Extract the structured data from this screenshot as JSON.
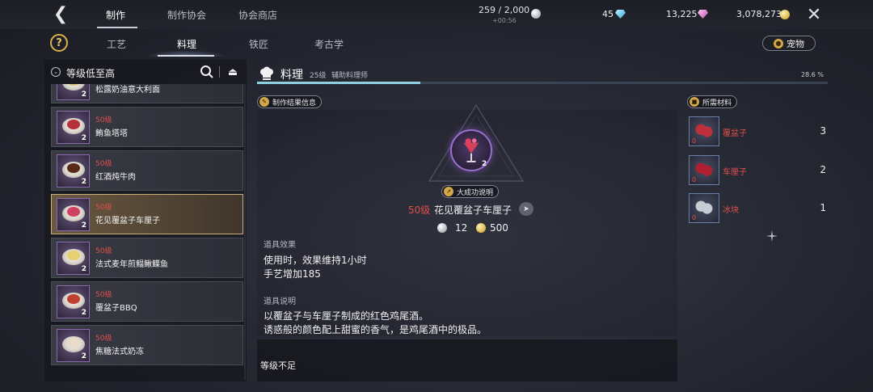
{
  "top_nav": {
    "tabs": [
      {
        "label": "制作",
        "active": true
      },
      {
        "label": "制作协会",
        "active": false
      },
      {
        "label": "协会商店",
        "active": false
      }
    ],
    "stamina": "259 / 2,000",
    "stamina_timer": "+00:56",
    "currency_1": "45",
    "currency_2": "13,225",
    "currency_3": "3,078,273"
  },
  "sub_tabs": [
    {
      "label": "工艺",
      "active": false
    },
    {
      "label": "料理",
      "active": true
    },
    {
      "label": "铁匠",
      "active": false
    },
    {
      "label": "考古学",
      "active": false
    }
  ],
  "pet_button": "宠物",
  "list": {
    "sort_label": "等级低至高",
    "items": [
      {
        "level": "",
        "name": "松露奶油意大利面",
        "qty": "2",
        "selected": false,
        "food_color": "#d8c27a"
      },
      {
        "level": "50级",
        "name": "鲔鱼塔塔",
        "qty": "2",
        "selected": false,
        "food_color": "#b8303a"
      },
      {
        "level": "50级",
        "name": "红酒炖牛肉",
        "qty": "2",
        "selected": false,
        "food_color": "#5a2a18"
      },
      {
        "level": "50级",
        "name": "花见覆盆子车厘子",
        "qty": "2",
        "selected": true,
        "food_color": "#d04060"
      },
      {
        "level": "50级",
        "name": "法式麦年煎鳎鳅鲽鱼",
        "qty": "2",
        "selected": false,
        "food_color": "#e8d070"
      },
      {
        "level": "50级",
        "name": "覆盆子BBQ",
        "qty": "2",
        "selected": false,
        "food_color": "#c04030"
      },
      {
        "level": "50级",
        "name": "焦糖法式奶冻",
        "qty": "2",
        "selected": false,
        "food_color": "#e8dcc8"
      }
    ]
  },
  "craft": {
    "title": "料理",
    "level": "25级",
    "rank": "辅助料理师",
    "progress_percent": 28.6,
    "progress_label": "28.6 %"
  },
  "result": {
    "info_label": "制作结果信息",
    "great_success_label": "大成功说明",
    "qty": "2",
    "level": "50级",
    "name": "花见覆盆子车厘子",
    "cost_silver": "12",
    "cost_gold": "500",
    "effect_title": "道具效果",
    "effect_lines": [
      "使用时，效果维持1小时",
      "手艺增加185"
    ],
    "desc_title": "道具说明",
    "desc_lines": [
      "以覆盆子与车厘子制成的红色鸡尾酒。",
      "诱惑般的颜色配上甜蜜的香气，是鸡尾酒中的极品。"
    ],
    "status": "等级不足"
  },
  "materials": {
    "label": "所需材料",
    "items": [
      {
        "name": "覆盆子",
        "owned": "0",
        "required": "3",
        "color": "#c0303c"
      },
      {
        "name": "车厘子",
        "owned": "0",
        "required": "2",
        "color": "#b02030"
      },
      {
        "name": "冰块",
        "owned": "0",
        "required": "1",
        "color": "#c8ccd4"
      }
    ]
  }
}
